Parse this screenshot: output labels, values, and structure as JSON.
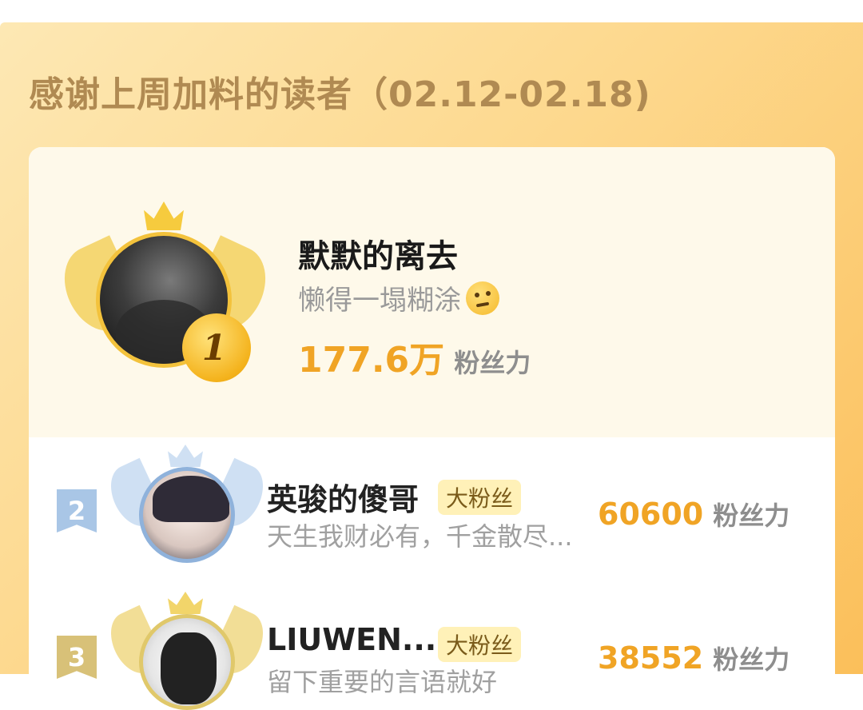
{
  "header": {
    "title": "感谢上周加料的读者（02.12-02.18)"
  },
  "top_reader": {
    "rank": "1",
    "name": "默默的离去",
    "signature": "懒得一塌糊涂",
    "score": "177.6万",
    "unit": "粉丝力"
  },
  "readers": [
    {
      "rank": "2",
      "name": "英骏的傻哥",
      "badge": "大粉丝",
      "signature": "天生我财必有，千金散尽...",
      "score": "60600",
      "unit": "粉丝力"
    },
    {
      "rank": "3",
      "name": "LIUWEN...",
      "badge": "大粉丝",
      "signature": "留下重要的言语就好",
      "score": "38552",
      "unit": "粉丝力"
    }
  ],
  "colors": {
    "accent": "#f0a425",
    "gold": "#f3c23c",
    "silver": "#8fb2db",
    "bronze": "#e0c86a"
  }
}
